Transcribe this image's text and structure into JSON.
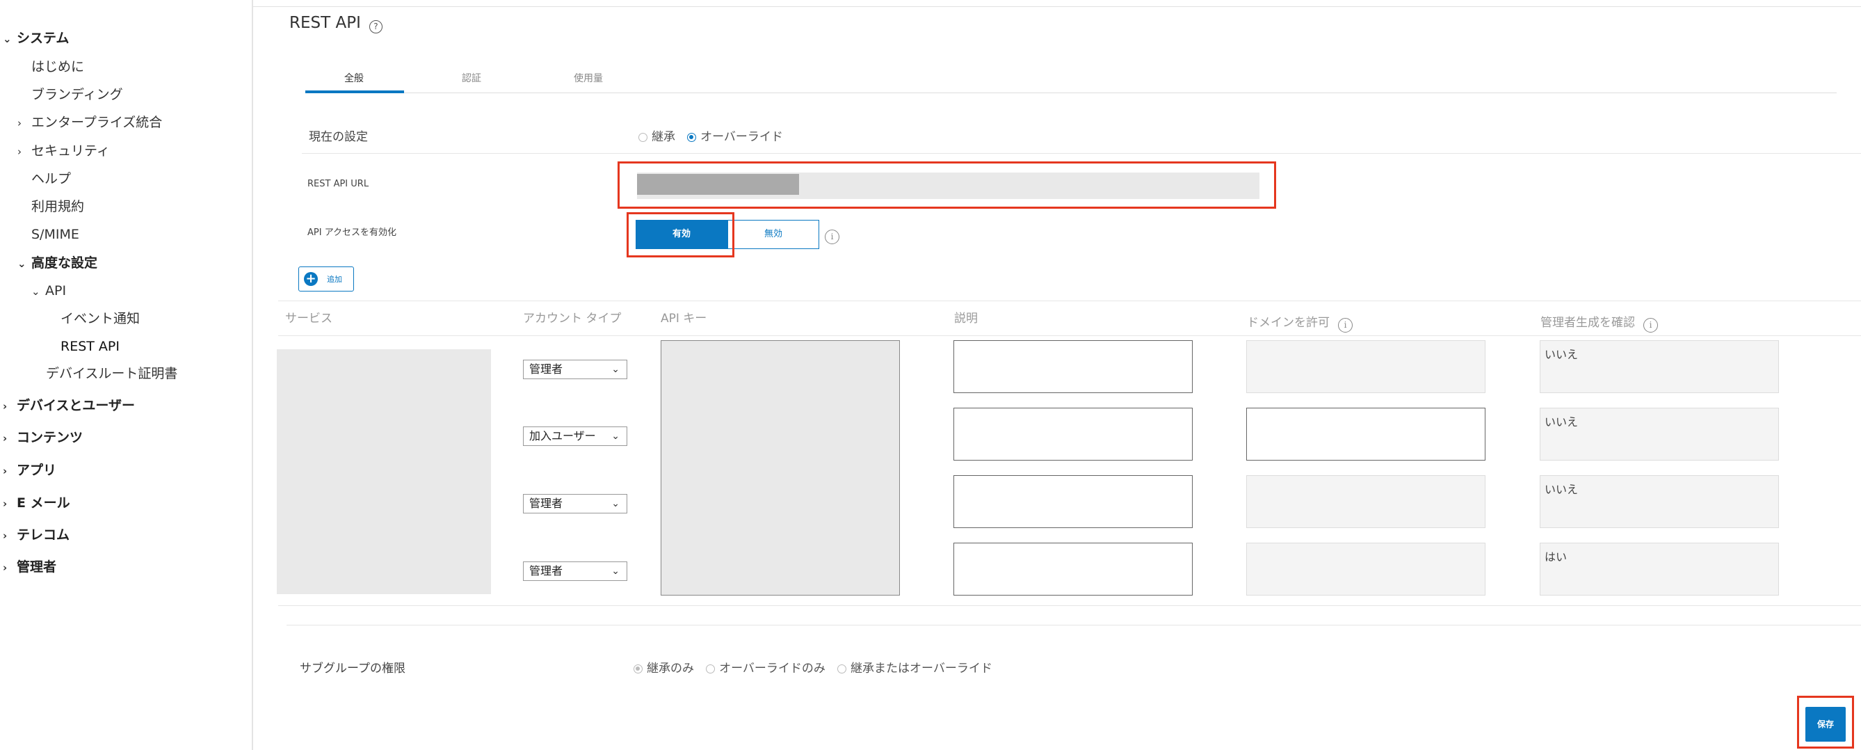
{
  "sidebar": {
    "items": [
      {
        "label": "システム",
        "chevron": "⌄",
        "level": 0,
        "bold": true
      },
      {
        "label": "はじめに",
        "level": 1
      },
      {
        "label": "ブランディング",
        "level": 1
      },
      {
        "label": "エンタープライズ統合",
        "chevron": "›",
        "level": 1
      },
      {
        "label": "セキュリティ",
        "chevron": "›",
        "level": 1
      },
      {
        "label": "ヘルプ",
        "level": 1
      },
      {
        "label": "利用規約",
        "level": 1
      },
      {
        "label": "S/MIME",
        "level": 1
      },
      {
        "label": "高度な設定",
        "chevron": "⌄",
        "level": 1,
        "bold": true
      },
      {
        "label": "API",
        "chevron": "⌄",
        "level": 2
      },
      {
        "label": "イベント通知",
        "level": 3
      },
      {
        "label": "REST API",
        "level": 3,
        "selected": true
      },
      {
        "label": "デバイスルート証明書",
        "level": 2
      },
      {
        "label": "デバイスとユーザー",
        "chevron": "›",
        "level": 0,
        "bold": true
      },
      {
        "label": "コンテンツ",
        "chevron": "›",
        "level": 0,
        "bold": true
      },
      {
        "label": "アプリ",
        "chevron": "›",
        "level": 0,
        "bold": true
      },
      {
        "label": "E メール",
        "chevron": "›",
        "level": 0,
        "bold": true
      },
      {
        "label": "テレコム",
        "chevron": "›",
        "level": 0,
        "bold": true
      },
      {
        "label": "管理者",
        "chevron": "›",
        "level": 0,
        "bold": true
      }
    ]
  },
  "page": {
    "title": "REST API",
    "help_icon": "?"
  },
  "tabs": [
    {
      "label": "全般",
      "active": true
    },
    {
      "label": "認証"
    },
    {
      "label": "使用量"
    }
  ],
  "current_setting": {
    "label": "現在の設定",
    "options": [
      "継承",
      "オーバーライド"
    ],
    "selected": "オーバーライド"
  },
  "rest_api_url": {
    "label": "REST API URL"
  },
  "api_access": {
    "label": "API アクセスを有効化",
    "enabled": "有効",
    "disabled": "無効",
    "selected": "有効",
    "info": "i"
  },
  "add_button": {
    "label": "追加"
  },
  "table": {
    "headers": [
      "サービス",
      "アカウント タイプ",
      "API キー",
      "説明",
      "ドメインを許可",
      "管理者生成を確認"
    ],
    "info": "i",
    "rows": [
      {
        "account_type": "管理者",
        "confirm": "いいえ",
        "domain_editable": false
      },
      {
        "account_type": "加入ユーザー",
        "confirm": "いいえ",
        "domain_editable": true
      },
      {
        "account_type": "管理者",
        "confirm": "いいえ",
        "domain_editable": false
      },
      {
        "account_type": "管理者",
        "confirm": "はい",
        "domain_editable": false
      }
    ]
  },
  "subgroup": {
    "label": "サブグループの権限",
    "options": [
      "継承のみ",
      "オーバーライドのみ",
      "継承またはオーバーライド"
    ],
    "selected": "継承のみ"
  },
  "save_button": {
    "label": "保存"
  },
  "colors": {
    "accent": "#0a78c2",
    "highlight": "#e5371f",
    "masked": "#e9e9e9"
  }
}
